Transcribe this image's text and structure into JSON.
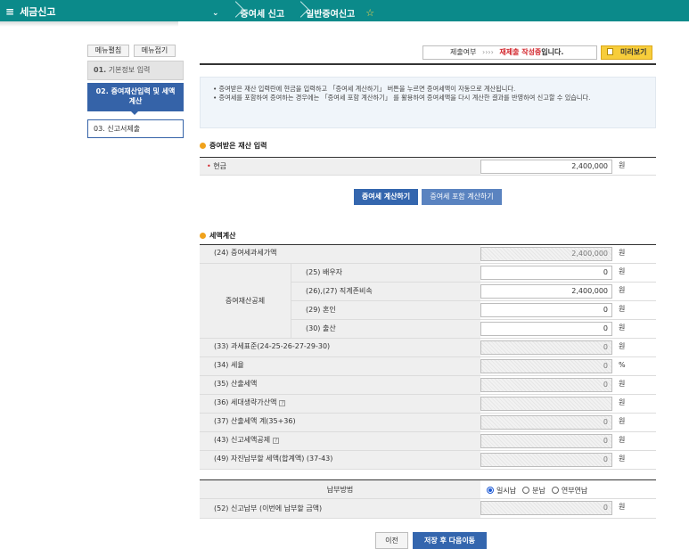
{
  "header": {
    "menu_title": "세금신고",
    "breadcrumbs": [
      "증여세 신고",
      "일반증여신고"
    ],
    "favorite_icon": "star-icon"
  },
  "side": {
    "edit_menu": "메뉴펼침",
    "collapse_menu": "메뉴접기",
    "steps": [
      {
        "num": "01.",
        "label": "기본정보 입력"
      },
      {
        "num": "02.",
        "label": "증여재산입력 및 세액",
        "label2": "계산"
      },
      {
        "num": "03.",
        "label": "신고서제출"
      }
    ]
  },
  "status": {
    "label": "제출여부",
    "arrows": "››››",
    "value_red": "재제출 작성중",
    "value_suffix": "입니다.",
    "preview": "미리보기"
  },
  "notice": [
    "• 증여받은 재산 입력란에 현금을 입력하고 「증여세 계산하기」 버튼을 누르면 증여세액이 자동으로 계산됩니다.",
    "• 증여세를 포함하여 증여하는 경우에는 「증여세 포함 계산하기」 를 활용하여 증여세액을 다시 계산한 결과를 반영하여 신고할 수 있습니다."
  ],
  "received": {
    "title": "증여받은 재산 입력",
    "required_mark": "•",
    "cash_label": "현금",
    "cash_value": "2,400,000",
    "unit": "원",
    "calc_button": "증여세 계산하기",
    "calc_incl_button": "증여세 포함 계산하기"
  },
  "tax": {
    "title": "세액계산",
    "unit_won": "원",
    "unit_pct": "%",
    "r24": {
      "label": "(24) 증여세과세가액",
      "value": "2,400,000"
    },
    "deduction_label": "증여재산공제",
    "deductions": [
      {
        "label": "(25) 배우자",
        "value": "0"
      },
      {
        "label": "(26),(27) 직계존비속",
        "value": "2,400,000"
      },
      {
        "label": "(29) 혼인",
        "value": "0"
      },
      {
        "label": "(30) 출산",
        "value": "0"
      }
    ],
    "r33": {
      "label": "(33) 과세표준(24-25-26-27-29-30)",
      "value": "0"
    },
    "r34": {
      "label": "(34) 세율",
      "value": "0"
    },
    "r35": {
      "label": "(35) 산출세액",
      "value": "0"
    },
    "r36": {
      "label": "(36) 세대생략가산액",
      "value": ""
    },
    "r37": {
      "label": "(37) 산출세액 계(35+36)",
      "value": "0"
    },
    "r43": {
      "label": "(43) 신고세액공제",
      "value": "0"
    },
    "r49": {
      "label": "(49) 자진납부할 세액(합계액) (37-43)",
      "value": "0"
    },
    "help_mark": "?"
  },
  "payment": {
    "label": "납부방법",
    "options": [
      "일시납",
      "분납",
      "연부연납"
    ],
    "selected": "일시납",
    "r52": {
      "label": "(52) 신고납부 (이번에 납부할 금액)",
      "value": "0"
    }
  },
  "footer": {
    "prev": "이전",
    "next": "저장 후 다음이동"
  }
}
